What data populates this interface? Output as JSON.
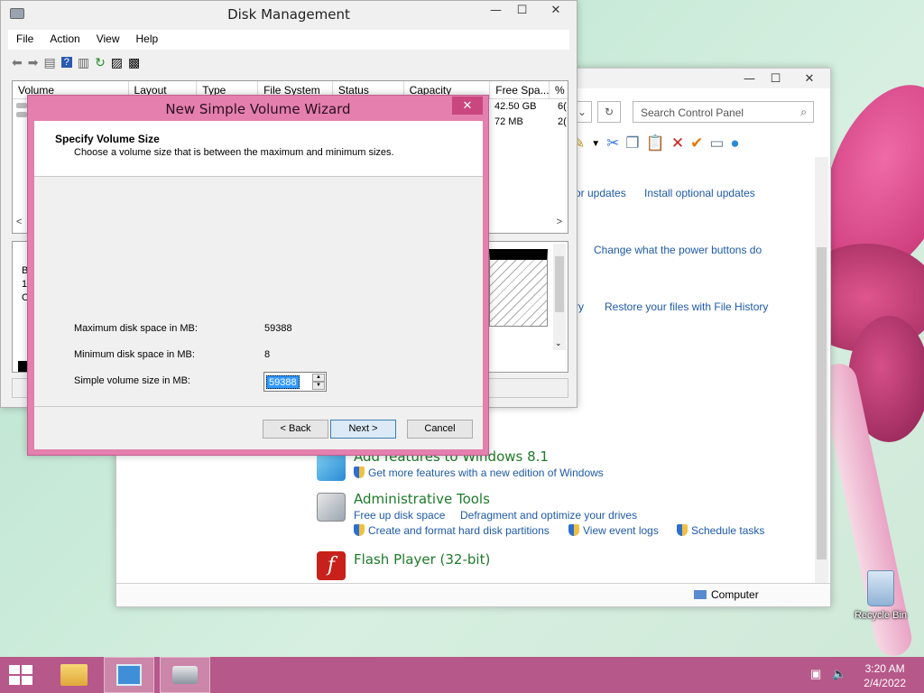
{
  "control_panel": {
    "search_placeholder": "Search Control Panel",
    "links_row1": [
      "or updates",
      "Install optional updates"
    ],
    "links_row2": [
      "Change what the power buttons do"
    ],
    "links_row3": [
      "ry",
      "Restore your files with File History"
    ],
    "add_features": {
      "heading": "Add features to Windows 8.1",
      "link": "Get more features with a new edition of Windows"
    },
    "admin_tools": {
      "heading": "Administrative Tools",
      "links": [
        "Free up disk space",
        "Defragment and optimize your drives",
        "Create and format hard disk partitions",
        "View event logs",
        "Schedule tasks"
      ]
    },
    "flash": {
      "heading": "Flash Player (32-bit)"
    },
    "status": "Computer"
  },
  "disk_mgmt": {
    "title": "Disk Management",
    "menu": [
      "File",
      "Action",
      "View",
      "Help"
    ],
    "columns": [
      "Volume",
      "Layout",
      "Type",
      "File System",
      "Status",
      "Capacity",
      "Free Spa...",
      "%"
    ],
    "rows": [
      {
        "free": "42.50 GB",
        "pct": "6("
      },
      {
        "free": "72 MB",
        "pct": "2("
      }
    ],
    "lower_labels": [
      "B",
      "1:",
      "O"
    ]
  },
  "wizard": {
    "title": "New Simple Volume Wizard",
    "header_title": "Specify Volume Size",
    "header_desc": "Choose a volume size that is between the maximum and minimum sizes.",
    "max_label": "Maximum disk space in MB:",
    "max_value": "59388",
    "min_label": "Minimum disk space in MB:",
    "min_value": "8",
    "size_label": "Simple volume size in MB:",
    "size_value": "59388",
    "back": "< Back",
    "next": "Next >",
    "cancel": "Cancel"
  },
  "desktop": {
    "recycle_bin": "Recycle Bin"
  },
  "taskbar": {
    "time": "3:20 AM",
    "date": "2/4/2022"
  }
}
